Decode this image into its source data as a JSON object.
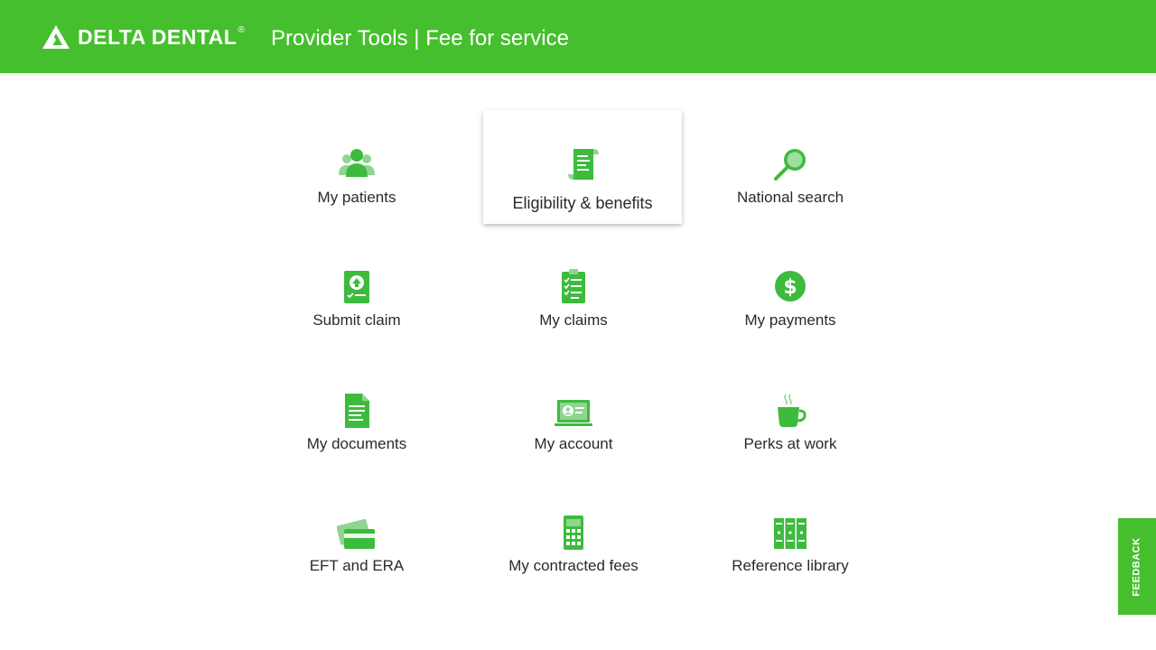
{
  "header": {
    "brand": "DELTA DENTAL",
    "registered": "®",
    "title": "Provider Tools | Fee for service"
  },
  "tiles": [
    {
      "label": "My patients",
      "icon": "patients-icon"
    },
    {
      "label": "Eligibility & benefits",
      "icon": "scroll-document-icon"
    },
    {
      "label": "National search",
      "icon": "magnifier-icon"
    },
    {
      "label": "Submit claim",
      "icon": "upload-claim-icon"
    },
    {
      "label": "My claims",
      "icon": "clipboard-checklist-icon"
    },
    {
      "label": "My payments",
      "icon": "dollar-coin-icon"
    },
    {
      "label": "My documents",
      "icon": "document-icon"
    },
    {
      "label": "My account",
      "icon": "laptop-account-icon"
    },
    {
      "label": "Perks at work",
      "icon": "coffee-cup-icon"
    },
    {
      "label": "EFT and ERA",
      "icon": "credit-card-icon"
    },
    {
      "label": "My contracted fees",
      "icon": "calculator-icon"
    },
    {
      "label": "Reference library",
      "icon": "binders-icon"
    }
  ],
  "feedback_label": "FEEDBACK",
  "colors": {
    "brand_green": "#46bf2e",
    "icon_green": "#3dbb3d",
    "text": "#2a2a2a"
  }
}
